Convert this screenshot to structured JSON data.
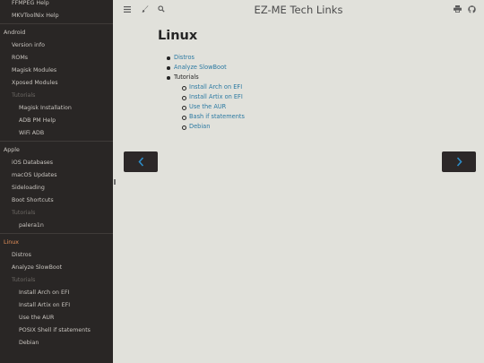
{
  "sidebar": {
    "items": [
      {
        "label": "FFMPEG Help",
        "level": "l1"
      },
      {
        "label": "MKVToolNix Help",
        "level": "l1"
      },
      {
        "divider": true
      },
      {
        "label": "Android",
        "level": "sec"
      },
      {
        "label": "Version info",
        "level": "l1"
      },
      {
        "label": "ROMs",
        "level": "l1"
      },
      {
        "label": "Magisk Modules",
        "level": "l1"
      },
      {
        "label": "Xposed Modules",
        "level": "l1"
      },
      {
        "label": "Tutorials",
        "level": "l1",
        "muted": true
      },
      {
        "label": "Magisk Installation",
        "level": "l2"
      },
      {
        "label": "ADB PM Help",
        "level": "l2"
      },
      {
        "label": "WiFi ADB",
        "level": "l2"
      },
      {
        "divider": true
      },
      {
        "label": "Apple",
        "level": "sec"
      },
      {
        "label": "iOS Databases",
        "level": "l1"
      },
      {
        "label": "macOS Updates",
        "level": "l1"
      },
      {
        "label": "Sideloading",
        "level": "l1"
      },
      {
        "label": "Boot Shortcuts",
        "level": "l1"
      },
      {
        "label": "Tutorials",
        "level": "l1",
        "muted": true
      },
      {
        "label": "palera1n",
        "level": "l2"
      },
      {
        "divider": true
      },
      {
        "label": "Linux",
        "level": "sec",
        "active": true
      },
      {
        "label": "Distros",
        "level": "l1"
      },
      {
        "label": "Analyze SlowBoot",
        "level": "l1"
      },
      {
        "label": "Tutorials",
        "level": "l1",
        "muted": true
      },
      {
        "label": "Install Arch on EFI",
        "level": "l2"
      },
      {
        "label": "Install Artix on EFI",
        "level": "l2"
      },
      {
        "label": "Use the AUR",
        "level": "l2"
      },
      {
        "label": "POSIX Shell if statements",
        "level": "l2"
      },
      {
        "label": "Debian",
        "level": "l2"
      }
    ]
  },
  "header": {
    "title": "EZ-ME Tech Links",
    "menu_icon": "menu-icon",
    "theme_icon": "paintbrush-icon",
    "search_icon": "search-icon",
    "print_icon": "print-icon",
    "repo_icon": "github-icon"
  },
  "main": {
    "title": "Linux",
    "links": [
      {
        "label": "Distros"
      },
      {
        "label": "Analyze SlowBoot"
      }
    ],
    "tutorials_label": "Tutorials",
    "tutorials": [
      {
        "label": "Install Arch on EFI"
      },
      {
        "label": "Install Artix on EFI"
      },
      {
        "label": "Use the AUR"
      },
      {
        "label": "Bash if statements"
      },
      {
        "label": "Debian"
      }
    ]
  },
  "nav": {
    "prev_icon": "chevron-left-icon",
    "next_icon": "chevron-right-icon"
  },
  "colors": {
    "sidebar_bg": "#292625",
    "page_bg": "#e1e1db",
    "link": "#2b79a2",
    "active": "#e4905a",
    "nav_button_bg": "#2c2828",
    "nav_arrow": "#2d8dc8"
  }
}
